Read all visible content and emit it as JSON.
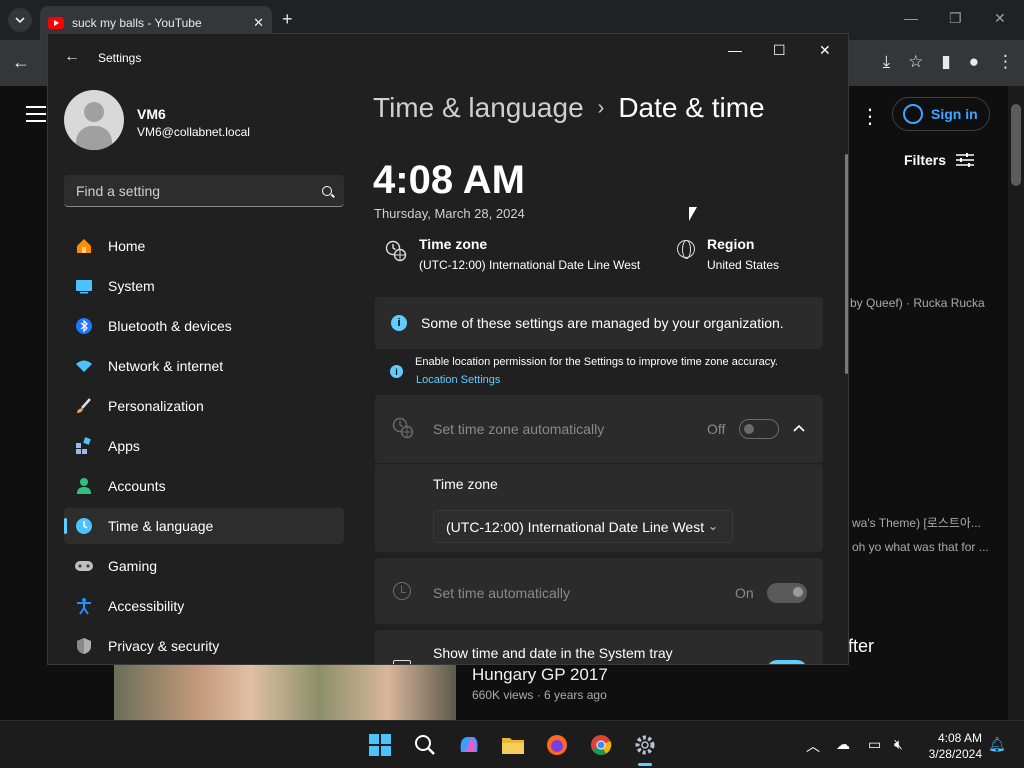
{
  "browser": {
    "tab_title": "suck my balls - YouTube",
    "new_tab": "+"
  },
  "youtube": {
    "sign_in": "Sign in",
    "filters": "Filters",
    "snippet_1": "by Queef) · Rucka Rucka",
    "snippet_2": "wa's Theme) [로스트아...",
    "snippet_3": "oh yo what was that for ...",
    "snippet_after": "fter",
    "video_title": "Hungary GP 2017",
    "video_meta": "660K views · 6 years ago"
  },
  "settings": {
    "window_title": "Settings",
    "profile": {
      "name": "VM6",
      "email": "VM6@collabnet.local"
    },
    "search_placeholder": "Find a setting",
    "nav": [
      {
        "label": "Home",
        "icon": "home-icon",
        "color": "#ff8c00"
      },
      {
        "label": "System",
        "icon": "system-icon",
        "color": "#4cc2ff"
      },
      {
        "label": "Bluetooth & devices",
        "icon": "bluetooth-icon",
        "color": "#1e90ff"
      },
      {
        "label": "Network & internet",
        "icon": "wifi-icon",
        "color": "#4cc2ff"
      },
      {
        "label": "Personalization",
        "icon": "brush-icon",
        "color": "#e8a060"
      },
      {
        "label": "Apps",
        "icon": "apps-icon",
        "color": "#9ab8e8"
      },
      {
        "label": "Accounts",
        "icon": "accounts-icon",
        "color": "#2ec27e"
      },
      {
        "label": "Time & language",
        "icon": "time-language-icon",
        "color": "#4cc2ff"
      },
      {
        "label": "Gaming",
        "icon": "gaming-icon",
        "color": "#c0c0c0"
      },
      {
        "label": "Accessibility",
        "icon": "accessibility-icon",
        "color": "#1e90ff"
      },
      {
        "label": "Privacy & security",
        "icon": "shield-icon",
        "color": "#b0b0b0"
      }
    ],
    "breadcrumb": {
      "parent": "Time & language",
      "current": "Date & time"
    },
    "clock": {
      "time": "4:08 AM",
      "date": "Thursday, March 28, 2024"
    },
    "time_zone_tile": {
      "title": "Time zone",
      "value": "(UTC-12:00) International Date Line West"
    },
    "region_tile": {
      "title": "Region",
      "value": "United States"
    },
    "managed_notice": "Some of these settings are managed by your organization.",
    "location_notice": "Enable location permission for the Settings to improve time zone accuracy.",
    "location_link": "Location Settings",
    "auto_timezone": {
      "label": "Set time zone automatically",
      "state": "Off"
    },
    "time_zone_label": "Time zone",
    "time_zone_value": "(UTC-12:00) International Date Line West",
    "auto_time": {
      "label": "Set time automatically",
      "state": "On"
    },
    "systray_label": "Show time and date in the System tray"
  },
  "taskbar": {
    "time": "4:08 AM",
    "date": "3/28/2024"
  }
}
